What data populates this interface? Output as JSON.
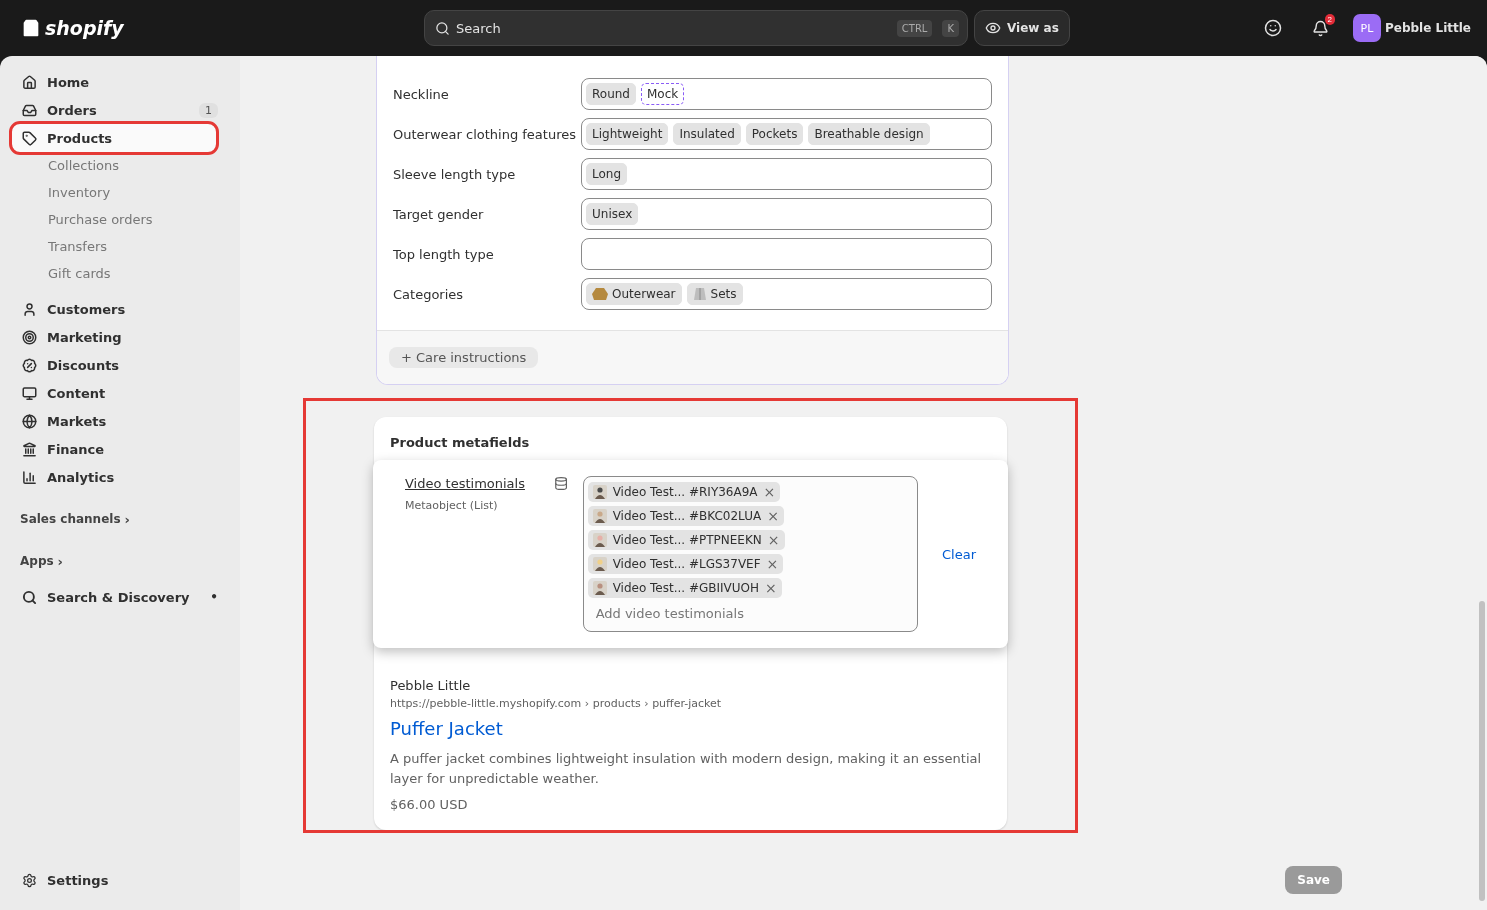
{
  "topbar": {
    "logo": "shopify",
    "search": {
      "placeholder": "Search",
      "keys": [
        "CTRL",
        "K"
      ]
    },
    "view_as": "View as",
    "notifications": "2",
    "avatar": "PL",
    "store": "Pebble Little"
  },
  "sidebar": {
    "items": [
      {
        "label": "Home",
        "selected": false,
        "highlighted": false
      },
      {
        "label": "Orders",
        "selected": false,
        "highlighted": false,
        "badge": "1"
      },
      {
        "label": "Products",
        "selected": true,
        "highlighted": true,
        "children": [
          {
            "label": "Collections"
          },
          {
            "label": "Inventory"
          },
          {
            "label": "Purchase orders"
          },
          {
            "label": "Transfers"
          },
          {
            "label": "Gift cards"
          }
        ]
      },
      {
        "label": "Customers",
        "selected": false,
        "highlighted": false
      },
      {
        "label": "Marketing",
        "selected": false,
        "highlighted": false
      },
      {
        "label": "Discounts",
        "selected": false,
        "highlighted": false
      },
      {
        "label": "Content",
        "selected": false,
        "highlighted": false
      },
      {
        "label": "Markets",
        "selected": false,
        "highlighted": false
      },
      {
        "label": "Finance",
        "selected": false,
        "highlighted": false
      },
      {
        "label": "Analytics",
        "selected": false,
        "highlighted": false
      }
    ],
    "sections": [
      {
        "label": "Sales channels",
        "arrow": "›"
      },
      {
        "label": "Apps",
        "arrow": "›"
      }
    ],
    "apps": [
      {
        "label": "Search & Discovery",
        "dot": "•"
      }
    ],
    "settings": "Settings"
  },
  "attributes": {
    "rows": [
      {
        "label": "Neckline",
        "kind": "tags",
        "chips": [
          {
            "label": "Round",
            "suggested": false
          },
          {
            "label": "Mock",
            "suggested": true
          }
        ]
      },
      {
        "label": "Outerwear clothing features",
        "kind": "tags",
        "chips": [
          {
            "label": "Lightweight",
            "suggested": false
          },
          {
            "label": "Insulated",
            "suggested": false
          },
          {
            "label": "Pockets",
            "suggested": false
          },
          {
            "label": "Breathable design",
            "suggested": false
          }
        ]
      },
      {
        "label": "Sleeve length type",
        "kind": "tags",
        "chips": [
          {
            "label": "Long",
            "suggested": false
          }
        ]
      },
      {
        "label": "Target gender",
        "kind": "tags",
        "chips": [
          {
            "label": "Unisex",
            "suggested": false
          }
        ]
      },
      {
        "label": "Top length type",
        "kind": "tags",
        "chips": []
      },
      {
        "label": "Categories",
        "kind": "categories",
        "chips": [
          {
            "label": "Outerwear",
            "suggested": false
          },
          {
            "label": "Sets",
            "suggested": false
          }
        ]
      }
    ],
    "add_button": "+ Care instructions"
  },
  "metafields": {
    "title": "Product metafields",
    "highlighted": true,
    "field": {
      "name": "Video testimonials",
      "type": "Metaobject (List)",
      "items": [
        {
          "label": "Video Test... #RIY36A9A",
          "remove": "×"
        },
        {
          "label": "Video Test... #BKC02LUA",
          "remove": "×"
        },
        {
          "label": "Video Test... #PTPNEEKN",
          "remove": "×"
        },
        {
          "label": "Video Test... #LGS37VEF",
          "remove": "×"
        },
        {
          "label": "Video Test... #GBIIVUOH",
          "remove": "×"
        }
      ],
      "placeholder": "Add video testimonials",
      "clear": "Clear"
    }
  },
  "seo_preview": {
    "store": "Pebble Little",
    "url": "https://pebble-little.myshopify.com › products › puffer-jacket",
    "title": "Puffer Jacket",
    "description": "A puffer jacket combines lightweight insulation with modern design, making it an essential layer for unpredictable weather.",
    "price": "$66.00 USD"
  },
  "save_button": {
    "label": "Save",
    "disabled": true
  }
}
